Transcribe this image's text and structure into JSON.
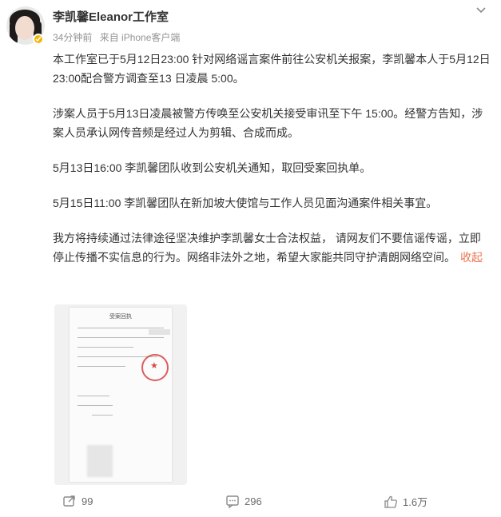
{
  "post": {
    "author": "李凯馨Eleanor工作室",
    "time": "34分钟前",
    "source": "来自 iPhone客户端",
    "paragraphs": [
      "本工作室已于5月12日23:00 针对网络谣言案件前往公安机关报案，李凯馨本人于5月12日23:00配合警方调查至13 日凌晨 5:00。",
      "涉案人员于5月13日凌晨被警方传唤至公安机关接受审讯至下午 15:00。经警方告知，涉案人员承认网传音频是经过人为剪辑、合成而成。",
      "5月13日16:00 李凯馨团队收到公安机关通知，取回受案回执单。",
      "5月15日11:00 李凯馨团队在新加坡大使馆与工作人员见面沟通案件相关事宜。",
      "我方将持续通过法律途径坚决维护李凯馨女士合法权益， 请网友们不要信谣传谣，立即停止传播不实信息的行为。网络非法外之地，希望大家能共同守护清朗网络空间。"
    ],
    "collapse_label": "收起"
  },
  "document_image": {
    "title": "受案回执"
  },
  "actions": {
    "repost_count": "99",
    "comment_count": "296",
    "like_count": "1.6万"
  },
  "colors": {
    "accent": "#eb7350",
    "meta": "#939393",
    "icon": "#6b6b6b",
    "verified": "#f7b500"
  }
}
